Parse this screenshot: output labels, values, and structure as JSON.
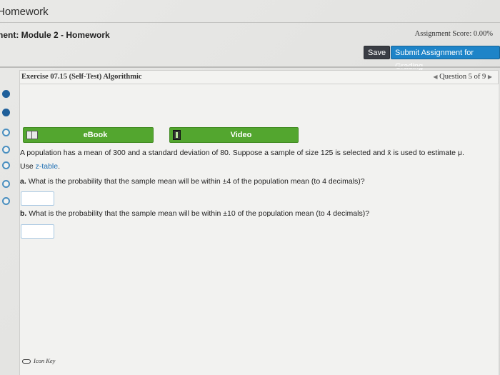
{
  "window": {
    "title": "Homework"
  },
  "header": {
    "assignment_title": "nent: Module 2 - Homework",
    "score": "Assignment Score: 0.00%",
    "save_label": "Save",
    "submit_label": "Submit Assignment for Grading"
  },
  "exercise": {
    "title": "Exercise 07.15 (Self-Test) Algorithmic",
    "question_nav": "Question 5 of 9"
  },
  "tabs": [
    {
      "label": "eBook",
      "icon": "book-icon"
    },
    {
      "label": "Video",
      "icon": "video-icon"
    }
  ],
  "question": {
    "intro": "A population has a mean of 300 and a standard deviation of 80. Suppose a sample of size 125 is selected and x̄ is used to estimate μ.",
    "use_prefix": "Use ",
    "table_link": "z-table",
    "table_suffix": ".",
    "part_a_label": "a.",
    "part_a": "What is the probability that the sample mean will be within ±4 of the population mean (to 4 decimals)?",
    "part_b_label": "b.",
    "part_b": "What is the probability that the sample mean will be within ±10 of the population mean (to 4 decimals)?",
    "answer_a": "",
    "answer_b": ""
  },
  "footer": {
    "icon_key": "Icon Key"
  },
  "colors": {
    "accent_blue": "#1e84c8",
    "tab_green": "#53a62f",
    "dot_blue": "#1f5f9a"
  }
}
